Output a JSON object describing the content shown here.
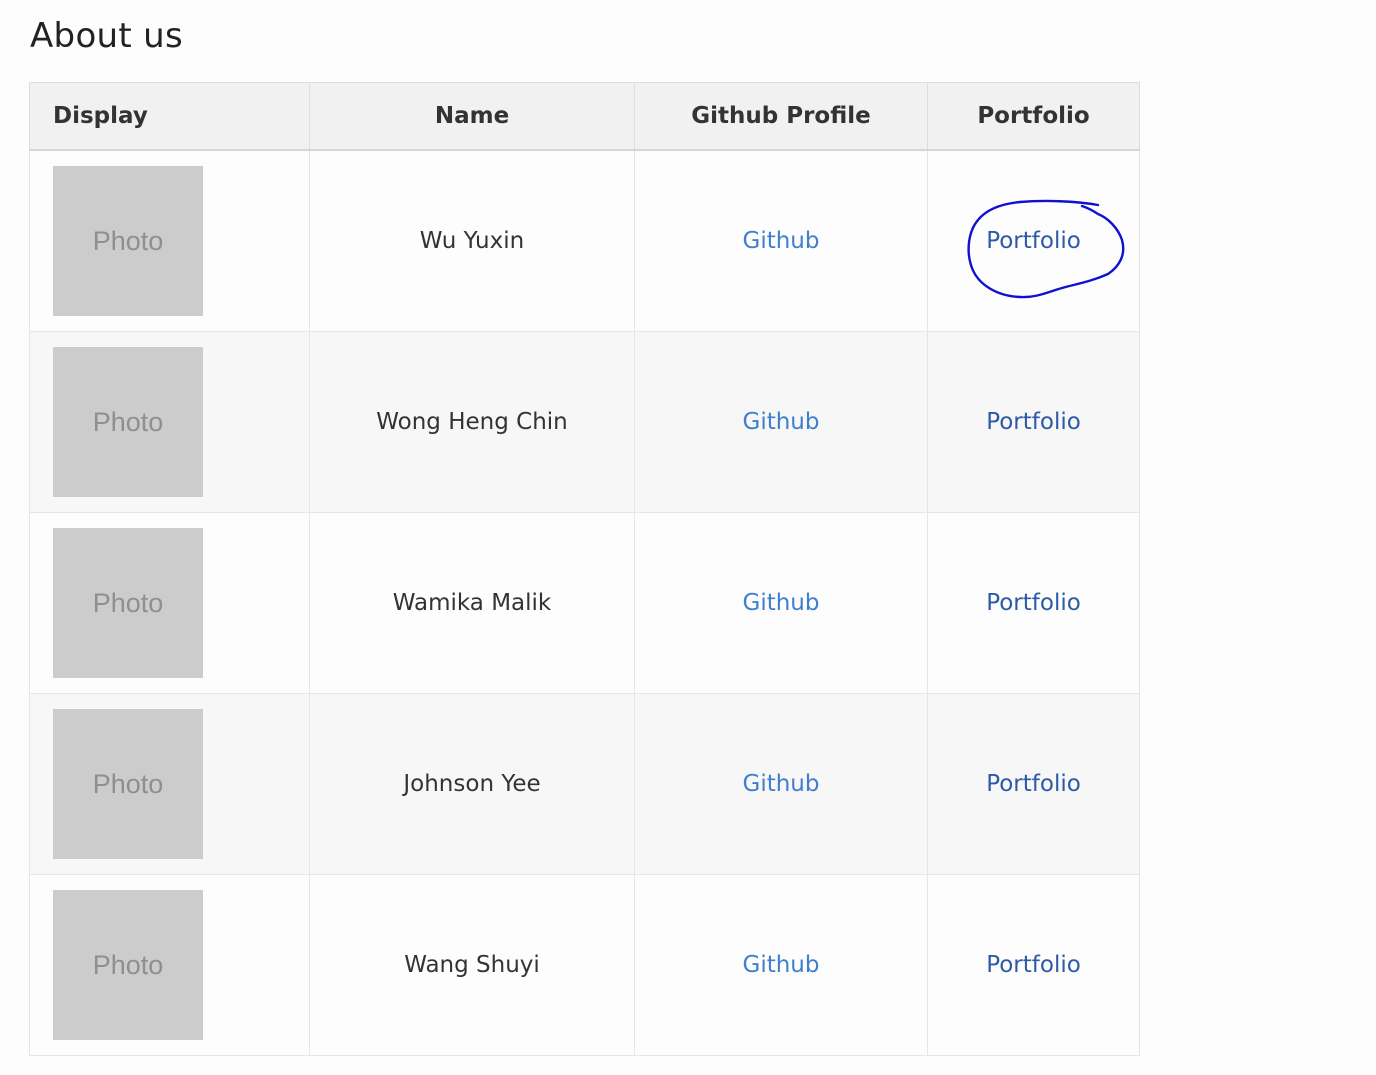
{
  "page": {
    "title": "About us"
  },
  "table": {
    "headers": {
      "display": "Display",
      "name": "Name",
      "github": "Github Profile",
      "portfolio": "Portfolio"
    },
    "rows": [
      {
        "photo": "Photo",
        "name": "Wu Yuxin",
        "github": "Github",
        "portfolio": "Portfolio"
      },
      {
        "photo": "Photo",
        "name": "Wong Heng Chin",
        "github": "Github",
        "portfolio": "Portfolio"
      },
      {
        "photo": "Photo",
        "name": "Wamika Malik",
        "github": "Github",
        "portfolio": "Portfolio"
      },
      {
        "photo": "Photo",
        "name": "Johnson Yee",
        "github": "Github",
        "portfolio": "Portfolio"
      },
      {
        "photo": "Photo",
        "name": "Wang Shuyi",
        "github": "Github",
        "portfolio": "Portfolio"
      }
    ]
  },
  "annotation": {
    "circled_item": "Portfolio",
    "color": "#1010d0"
  },
  "colors": {
    "github_link": "#3f7fce",
    "portfolio_link": "#2d5aa6",
    "header_bg": "#f1f1f1",
    "photo_placeholder": "#cccccc"
  }
}
